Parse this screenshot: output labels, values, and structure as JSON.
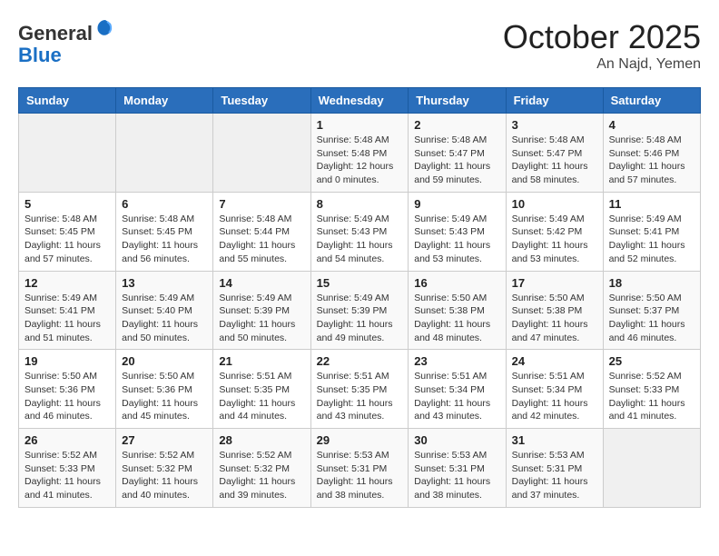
{
  "header": {
    "logo_line1": "General",
    "logo_line2": "Blue",
    "month": "October 2025",
    "location": "An Najd, Yemen"
  },
  "weekdays": [
    "Sunday",
    "Monday",
    "Tuesday",
    "Wednesday",
    "Thursday",
    "Friday",
    "Saturday"
  ],
  "weeks": [
    [
      {
        "day": "",
        "info": ""
      },
      {
        "day": "",
        "info": ""
      },
      {
        "day": "",
        "info": ""
      },
      {
        "day": "1",
        "info": "Sunrise: 5:48 AM\nSunset: 5:48 PM\nDaylight: 12 hours\nand 0 minutes."
      },
      {
        "day": "2",
        "info": "Sunrise: 5:48 AM\nSunset: 5:47 PM\nDaylight: 11 hours\nand 59 minutes."
      },
      {
        "day": "3",
        "info": "Sunrise: 5:48 AM\nSunset: 5:47 PM\nDaylight: 11 hours\nand 58 minutes."
      },
      {
        "day": "4",
        "info": "Sunrise: 5:48 AM\nSunset: 5:46 PM\nDaylight: 11 hours\nand 57 minutes."
      }
    ],
    [
      {
        "day": "5",
        "info": "Sunrise: 5:48 AM\nSunset: 5:45 PM\nDaylight: 11 hours\nand 57 minutes."
      },
      {
        "day": "6",
        "info": "Sunrise: 5:48 AM\nSunset: 5:45 PM\nDaylight: 11 hours\nand 56 minutes."
      },
      {
        "day": "7",
        "info": "Sunrise: 5:48 AM\nSunset: 5:44 PM\nDaylight: 11 hours\nand 55 minutes."
      },
      {
        "day": "8",
        "info": "Sunrise: 5:49 AM\nSunset: 5:43 PM\nDaylight: 11 hours\nand 54 minutes."
      },
      {
        "day": "9",
        "info": "Sunrise: 5:49 AM\nSunset: 5:43 PM\nDaylight: 11 hours\nand 53 minutes."
      },
      {
        "day": "10",
        "info": "Sunrise: 5:49 AM\nSunset: 5:42 PM\nDaylight: 11 hours\nand 53 minutes."
      },
      {
        "day": "11",
        "info": "Sunrise: 5:49 AM\nSunset: 5:41 PM\nDaylight: 11 hours\nand 52 minutes."
      }
    ],
    [
      {
        "day": "12",
        "info": "Sunrise: 5:49 AM\nSunset: 5:41 PM\nDaylight: 11 hours\nand 51 minutes."
      },
      {
        "day": "13",
        "info": "Sunrise: 5:49 AM\nSunset: 5:40 PM\nDaylight: 11 hours\nand 50 minutes."
      },
      {
        "day": "14",
        "info": "Sunrise: 5:49 AM\nSunset: 5:39 PM\nDaylight: 11 hours\nand 50 minutes."
      },
      {
        "day": "15",
        "info": "Sunrise: 5:49 AM\nSunset: 5:39 PM\nDaylight: 11 hours\nand 49 minutes."
      },
      {
        "day": "16",
        "info": "Sunrise: 5:50 AM\nSunset: 5:38 PM\nDaylight: 11 hours\nand 48 minutes."
      },
      {
        "day": "17",
        "info": "Sunrise: 5:50 AM\nSunset: 5:38 PM\nDaylight: 11 hours\nand 47 minutes."
      },
      {
        "day": "18",
        "info": "Sunrise: 5:50 AM\nSunset: 5:37 PM\nDaylight: 11 hours\nand 46 minutes."
      }
    ],
    [
      {
        "day": "19",
        "info": "Sunrise: 5:50 AM\nSunset: 5:36 PM\nDaylight: 11 hours\nand 46 minutes."
      },
      {
        "day": "20",
        "info": "Sunrise: 5:50 AM\nSunset: 5:36 PM\nDaylight: 11 hours\nand 45 minutes."
      },
      {
        "day": "21",
        "info": "Sunrise: 5:51 AM\nSunset: 5:35 PM\nDaylight: 11 hours\nand 44 minutes."
      },
      {
        "day": "22",
        "info": "Sunrise: 5:51 AM\nSunset: 5:35 PM\nDaylight: 11 hours\nand 43 minutes."
      },
      {
        "day": "23",
        "info": "Sunrise: 5:51 AM\nSunset: 5:34 PM\nDaylight: 11 hours\nand 43 minutes."
      },
      {
        "day": "24",
        "info": "Sunrise: 5:51 AM\nSunset: 5:34 PM\nDaylight: 11 hours\nand 42 minutes."
      },
      {
        "day": "25",
        "info": "Sunrise: 5:52 AM\nSunset: 5:33 PM\nDaylight: 11 hours\nand 41 minutes."
      }
    ],
    [
      {
        "day": "26",
        "info": "Sunrise: 5:52 AM\nSunset: 5:33 PM\nDaylight: 11 hours\nand 41 minutes."
      },
      {
        "day": "27",
        "info": "Sunrise: 5:52 AM\nSunset: 5:32 PM\nDaylight: 11 hours\nand 40 minutes."
      },
      {
        "day": "28",
        "info": "Sunrise: 5:52 AM\nSunset: 5:32 PM\nDaylight: 11 hours\nand 39 minutes."
      },
      {
        "day": "29",
        "info": "Sunrise: 5:53 AM\nSunset: 5:31 PM\nDaylight: 11 hours\nand 38 minutes."
      },
      {
        "day": "30",
        "info": "Sunrise: 5:53 AM\nSunset: 5:31 PM\nDaylight: 11 hours\nand 38 minutes."
      },
      {
        "day": "31",
        "info": "Sunrise: 5:53 AM\nSunset: 5:31 PM\nDaylight: 11 hours\nand 37 minutes."
      },
      {
        "day": "",
        "info": ""
      }
    ]
  ]
}
